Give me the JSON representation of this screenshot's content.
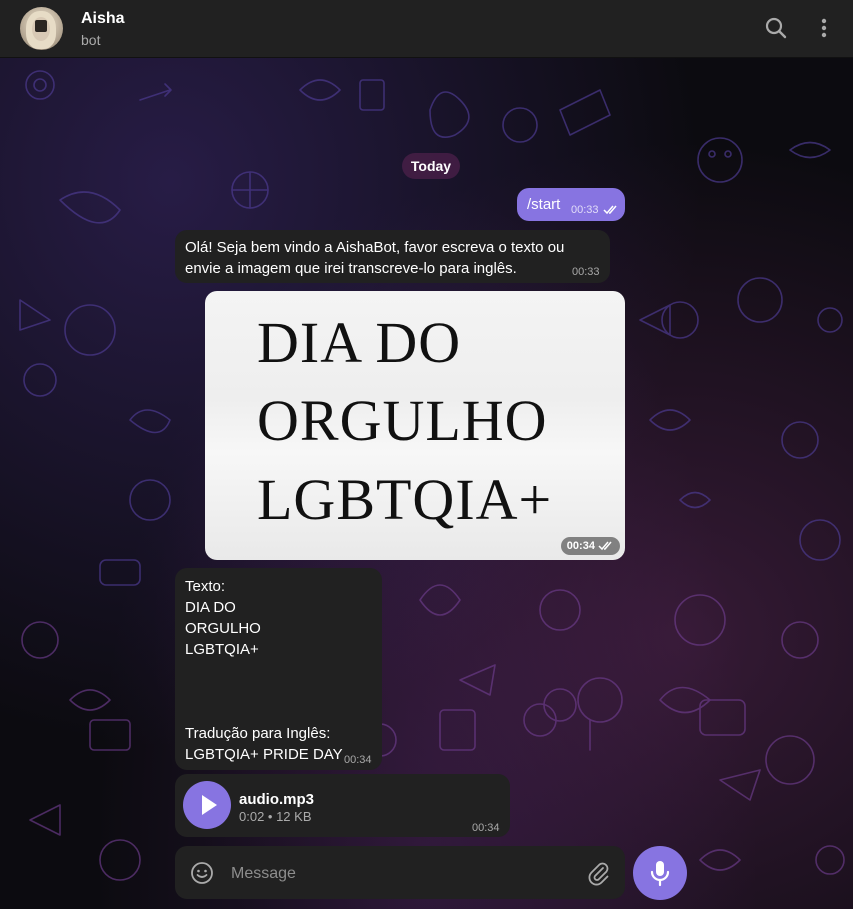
{
  "header": {
    "name": "Aisha",
    "status": "bot",
    "search_icon": "search-icon",
    "menu_icon": "more-vertical-icon"
  },
  "date_separator": "Today",
  "messages": [
    {
      "direction": "out",
      "text": "/start",
      "time": "00:33",
      "read": true
    },
    {
      "direction": "in",
      "text_lines": [
        "Olá! Seja bem vindo a AishaBot, favor escreva o texto ou",
        "envie a imagem que irei transcreve-lo para inglês."
      ],
      "time": "00:33"
    },
    {
      "direction": "out",
      "type": "image",
      "image_lines": [
        "DIA DO",
        "ORGULHO",
        "LGBTQIA+"
      ],
      "time": "00:34",
      "read": true
    },
    {
      "direction": "in",
      "text_lines": [
        "Texto:",
        "DIA DO",
        "ORGULHO",
        "LGBTQIA+",
        "",
        "",
        "",
        "Tradução para Inglês:",
        "LGBTQIA+ PRIDE DAY"
      ],
      "time": "00:34"
    },
    {
      "direction": "in",
      "type": "audio",
      "file_name": "audio.mp3",
      "meta": "0:02 • 12 KB",
      "time": "00:34",
      "icon": "play-icon"
    }
  ],
  "composer": {
    "placeholder": "Message",
    "emoji_icon": "emoji-icon",
    "attach_icon": "paperclip-icon",
    "mic_icon": "microphone-icon"
  },
  "colors": {
    "accent": "#8774e1",
    "bubble_in": "#212121",
    "header_bg": "#212121"
  }
}
